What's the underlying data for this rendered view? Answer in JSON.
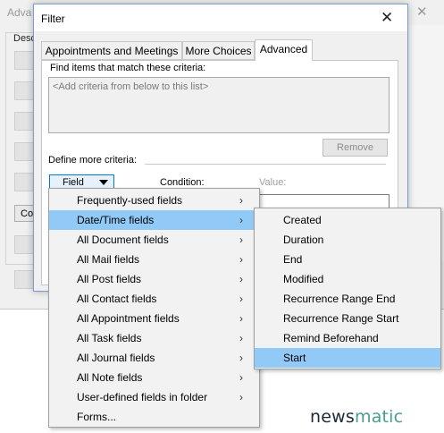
{
  "background_dialog": {
    "title": "Adva",
    "close_glyph": "✕",
    "group_label": "Desc",
    "button_text": "Co"
  },
  "filter_dialog": {
    "title": "Filter",
    "close_glyph": "✕",
    "tabs": [
      {
        "label": "Appointments and Meetings",
        "active": false
      },
      {
        "label": "More Choices",
        "active": false
      },
      {
        "label": "Advanced",
        "active": true
      }
    ],
    "find_label": "Find items that match these criteria:",
    "criteria_placeholder": "<Add criteria from below to this list>",
    "remove_button": "Remove",
    "define_label": "Define more criteria:",
    "field_button": "Field",
    "condition_label": "Condition:",
    "value_label": "Value:"
  },
  "field_menu": {
    "items": [
      {
        "label": "Frequently-used fields",
        "has_submenu": true,
        "highlighted": false
      },
      {
        "label": "Date/Time fields",
        "has_submenu": true,
        "highlighted": true
      },
      {
        "label": "All Document fields",
        "has_submenu": true,
        "highlighted": false
      },
      {
        "label": "All Mail fields",
        "has_submenu": true,
        "highlighted": false
      },
      {
        "label": "All Post fields",
        "has_submenu": true,
        "highlighted": false
      },
      {
        "label": "All Contact fields",
        "has_submenu": true,
        "highlighted": false
      },
      {
        "label": "All Appointment fields",
        "has_submenu": true,
        "highlighted": false
      },
      {
        "label": "All Task fields",
        "has_submenu": true,
        "highlighted": false
      },
      {
        "label": "All Journal fields",
        "has_submenu": true,
        "highlighted": false
      },
      {
        "label": "All Note fields",
        "has_submenu": true,
        "highlighted": false
      },
      {
        "label": "User-defined fields in folder",
        "has_submenu": true,
        "highlighted": false
      },
      {
        "label": "Forms...",
        "has_submenu": false,
        "highlighted": false
      }
    ],
    "submenu_arrow": "›"
  },
  "datetime_submenu": {
    "items": [
      {
        "label": "Created",
        "highlighted": false
      },
      {
        "label": "Duration",
        "highlighted": false
      },
      {
        "label": "End",
        "highlighted": false
      },
      {
        "label": "Modified",
        "highlighted": false
      },
      {
        "label": "Recurrence Range End",
        "highlighted": false
      },
      {
        "label": "Recurrence Range Start",
        "highlighted": false
      },
      {
        "label": "Remind Beforehand",
        "highlighted": false
      },
      {
        "label": "Start",
        "highlighted": true
      }
    ]
  },
  "watermark": {
    "text": "newsmatic",
    "colors": {
      "dark": "#1b2a3a",
      "accent": "#4a9d8f"
    }
  },
  "colors": {
    "menu_highlight": "#91c9f7",
    "focus_border": "#0078d7",
    "dialog_bg": "#f0f0f0"
  }
}
